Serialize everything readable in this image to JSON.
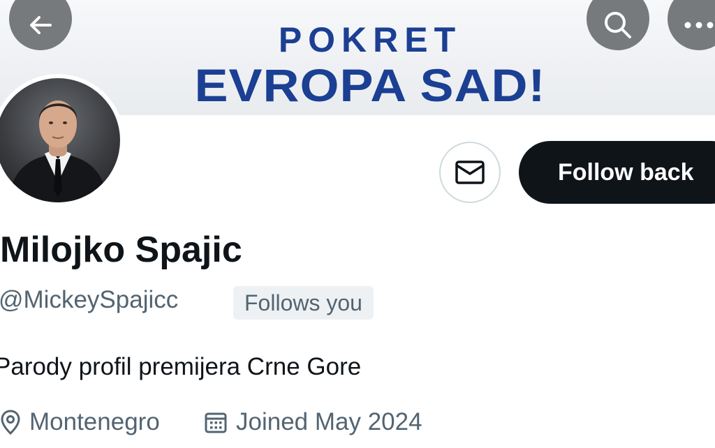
{
  "banner": {
    "line1": "POKRET",
    "line2": "EVROPA SAD!"
  },
  "header": {
    "back_icon": "arrow-left-icon",
    "search_icon": "search-icon",
    "more_icon": "more-horizontal-icon"
  },
  "actions": {
    "message_icon": "envelope-icon",
    "follow_label": "Follow back"
  },
  "profile": {
    "display_name": "Milojko Spajic",
    "handle": "@MickeySpajicc",
    "follows_you": "Follows you",
    "bio": "Parody profil premijera Crne Gore",
    "location": "Montenegro",
    "joined": "Joined May 2024"
  },
  "colors": {
    "banner_text": "#1b3f93",
    "primary_text": "#0f1419",
    "secondary_text": "#536471",
    "follow_button_bg": "#0f1419"
  }
}
